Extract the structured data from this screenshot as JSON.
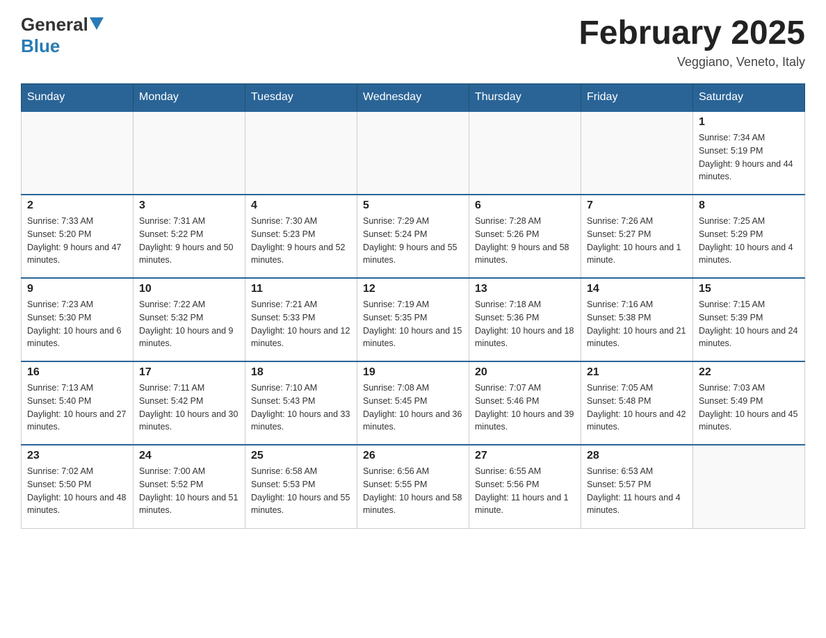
{
  "header": {
    "logo_general": "General",
    "logo_blue": "Blue",
    "title": "February 2025",
    "subtitle": "Veggiano, Veneto, Italy"
  },
  "days_of_week": [
    "Sunday",
    "Monday",
    "Tuesday",
    "Wednesday",
    "Thursday",
    "Friday",
    "Saturday"
  ],
  "weeks": [
    {
      "days": [
        {
          "number": "",
          "info": ""
        },
        {
          "number": "",
          "info": ""
        },
        {
          "number": "",
          "info": ""
        },
        {
          "number": "",
          "info": ""
        },
        {
          "number": "",
          "info": ""
        },
        {
          "number": "",
          "info": ""
        },
        {
          "number": "1",
          "info": "Sunrise: 7:34 AM\nSunset: 5:19 PM\nDaylight: 9 hours and 44 minutes."
        }
      ]
    },
    {
      "days": [
        {
          "number": "2",
          "info": "Sunrise: 7:33 AM\nSunset: 5:20 PM\nDaylight: 9 hours and 47 minutes."
        },
        {
          "number": "3",
          "info": "Sunrise: 7:31 AM\nSunset: 5:22 PM\nDaylight: 9 hours and 50 minutes."
        },
        {
          "number": "4",
          "info": "Sunrise: 7:30 AM\nSunset: 5:23 PM\nDaylight: 9 hours and 52 minutes."
        },
        {
          "number": "5",
          "info": "Sunrise: 7:29 AM\nSunset: 5:24 PM\nDaylight: 9 hours and 55 minutes."
        },
        {
          "number": "6",
          "info": "Sunrise: 7:28 AM\nSunset: 5:26 PM\nDaylight: 9 hours and 58 minutes."
        },
        {
          "number": "7",
          "info": "Sunrise: 7:26 AM\nSunset: 5:27 PM\nDaylight: 10 hours and 1 minute."
        },
        {
          "number": "8",
          "info": "Sunrise: 7:25 AM\nSunset: 5:29 PM\nDaylight: 10 hours and 4 minutes."
        }
      ]
    },
    {
      "days": [
        {
          "number": "9",
          "info": "Sunrise: 7:23 AM\nSunset: 5:30 PM\nDaylight: 10 hours and 6 minutes."
        },
        {
          "number": "10",
          "info": "Sunrise: 7:22 AM\nSunset: 5:32 PM\nDaylight: 10 hours and 9 minutes."
        },
        {
          "number": "11",
          "info": "Sunrise: 7:21 AM\nSunset: 5:33 PM\nDaylight: 10 hours and 12 minutes."
        },
        {
          "number": "12",
          "info": "Sunrise: 7:19 AM\nSunset: 5:35 PM\nDaylight: 10 hours and 15 minutes."
        },
        {
          "number": "13",
          "info": "Sunrise: 7:18 AM\nSunset: 5:36 PM\nDaylight: 10 hours and 18 minutes."
        },
        {
          "number": "14",
          "info": "Sunrise: 7:16 AM\nSunset: 5:38 PM\nDaylight: 10 hours and 21 minutes."
        },
        {
          "number": "15",
          "info": "Sunrise: 7:15 AM\nSunset: 5:39 PM\nDaylight: 10 hours and 24 minutes."
        }
      ]
    },
    {
      "days": [
        {
          "number": "16",
          "info": "Sunrise: 7:13 AM\nSunset: 5:40 PM\nDaylight: 10 hours and 27 minutes."
        },
        {
          "number": "17",
          "info": "Sunrise: 7:11 AM\nSunset: 5:42 PM\nDaylight: 10 hours and 30 minutes."
        },
        {
          "number": "18",
          "info": "Sunrise: 7:10 AM\nSunset: 5:43 PM\nDaylight: 10 hours and 33 minutes."
        },
        {
          "number": "19",
          "info": "Sunrise: 7:08 AM\nSunset: 5:45 PM\nDaylight: 10 hours and 36 minutes."
        },
        {
          "number": "20",
          "info": "Sunrise: 7:07 AM\nSunset: 5:46 PM\nDaylight: 10 hours and 39 minutes."
        },
        {
          "number": "21",
          "info": "Sunrise: 7:05 AM\nSunset: 5:48 PM\nDaylight: 10 hours and 42 minutes."
        },
        {
          "number": "22",
          "info": "Sunrise: 7:03 AM\nSunset: 5:49 PM\nDaylight: 10 hours and 45 minutes."
        }
      ]
    },
    {
      "days": [
        {
          "number": "23",
          "info": "Sunrise: 7:02 AM\nSunset: 5:50 PM\nDaylight: 10 hours and 48 minutes."
        },
        {
          "number": "24",
          "info": "Sunrise: 7:00 AM\nSunset: 5:52 PM\nDaylight: 10 hours and 51 minutes."
        },
        {
          "number": "25",
          "info": "Sunrise: 6:58 AM\nSunset: 5:53 PM\nDaylight: 10 hours and 55 minutes."
        },
        {
          "number": "26",
          "info": "Sunrise: 6:56 AM\nSunset: 5:55 PM\nDaylight: 10 hours and 58 minutes."
        },
        {
          "number": "27",
          "info": "Sunrise: 6:55 AM\nSunset: 5:56 PM\nDaylight: 11 hours and 1 minute."
        },
        {
          "number": "28",
          "info": "Sunrise: 6:53 AM\nSunset: 5:57 PM\nDaylight: 11 hours and 4 minutes."
        },
        {
          "number": "",
          "info": ""
        }
      ]
    }
  ]
}
